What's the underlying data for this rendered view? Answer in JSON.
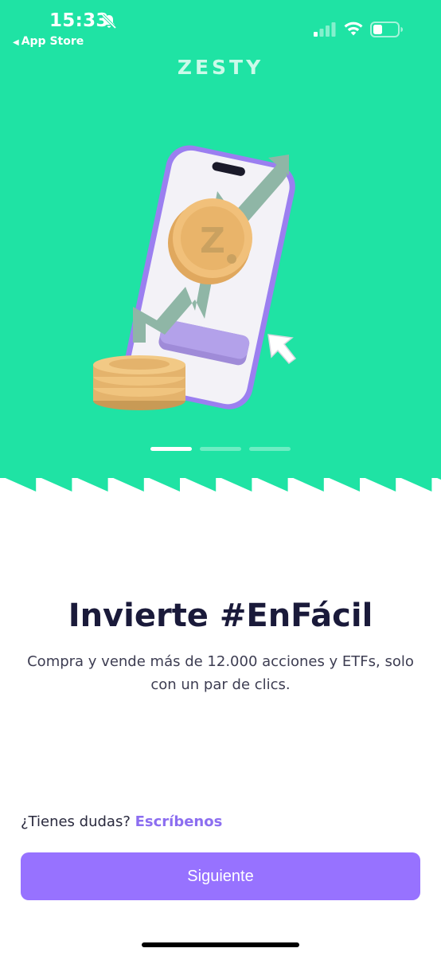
{
  "status_bar": {
    "time": "15:33",
    "back_app": "App Store",
    "bell_icon": "bell-slash-icon",
    "signal_icon": "cellular-signal-icon",
    "wifi_icon": "wifi-icon",
    "battery_icon": "battery-icon"
  },
  "brand": {
    "logo_text": "ZESTY",
    "hero_color": "#1fe3a4",
    "accent_color": "#9772ff"
  },
  "onboarding": {
    "slides_count": 3,
    "active_slide": 1,
    "title": "Invierte #EnFácil",
    "subtitle": "Compra y vende más de 12.000 acciones y ETFs, solo con un par de clics."
  },
  "help": {
    "question": "¿Tienes dudas?",
    "link": "Escríbenos"
  },
  "actions": {
    "next_label": "Siguiente"
  }
}
